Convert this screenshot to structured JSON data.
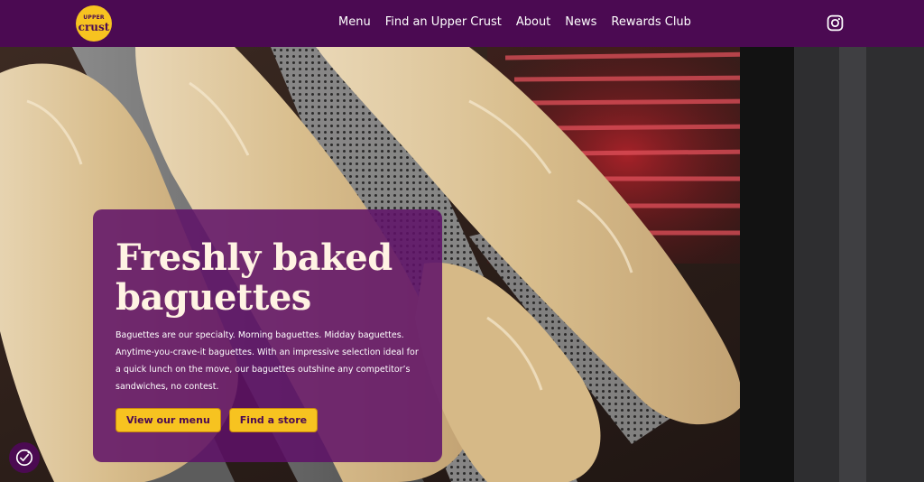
{
  "brand": {
    "logo_line1": "UPPER",
    "logo_line2": "crust"
  },
  "nav": {
    "items": [
      {
        "label": "Menu"
      },
      {
        "label": "Find an Upper Crust"
      },
      {
        "label": "About"
      },
      {
        "label": "News"
      },
      {
        "label": "Rewards Club"
      }
    ]
  },
  "social": {
    "icon": "instagram-icon"
  },
  "hero": {
    "headline": "Freshly baked baguettes",
    "body": "Baguettes are our specialty. Morning baguettes. Midday baguettes. Anytime-you-crave-it baguettes. With an impressive selection ideal for a quick lunch on the move, our baguettes outshine any competitor’s sandwiches, no contest.",
    "buttons": [
      {
        "label": "View our menu"
      },
      {
        "label": "Find a store"
      }
    ]
  },
  "accessibility": {
    "icon": "accessibility-icon"
  },
  "colors": {
    "brand_purple": "#4b0a52",
    "card_purple": "#5e1068",
    "accent_yellow": "#f7c320",
    "headline_cream": "#fff3e3"
  }
}
